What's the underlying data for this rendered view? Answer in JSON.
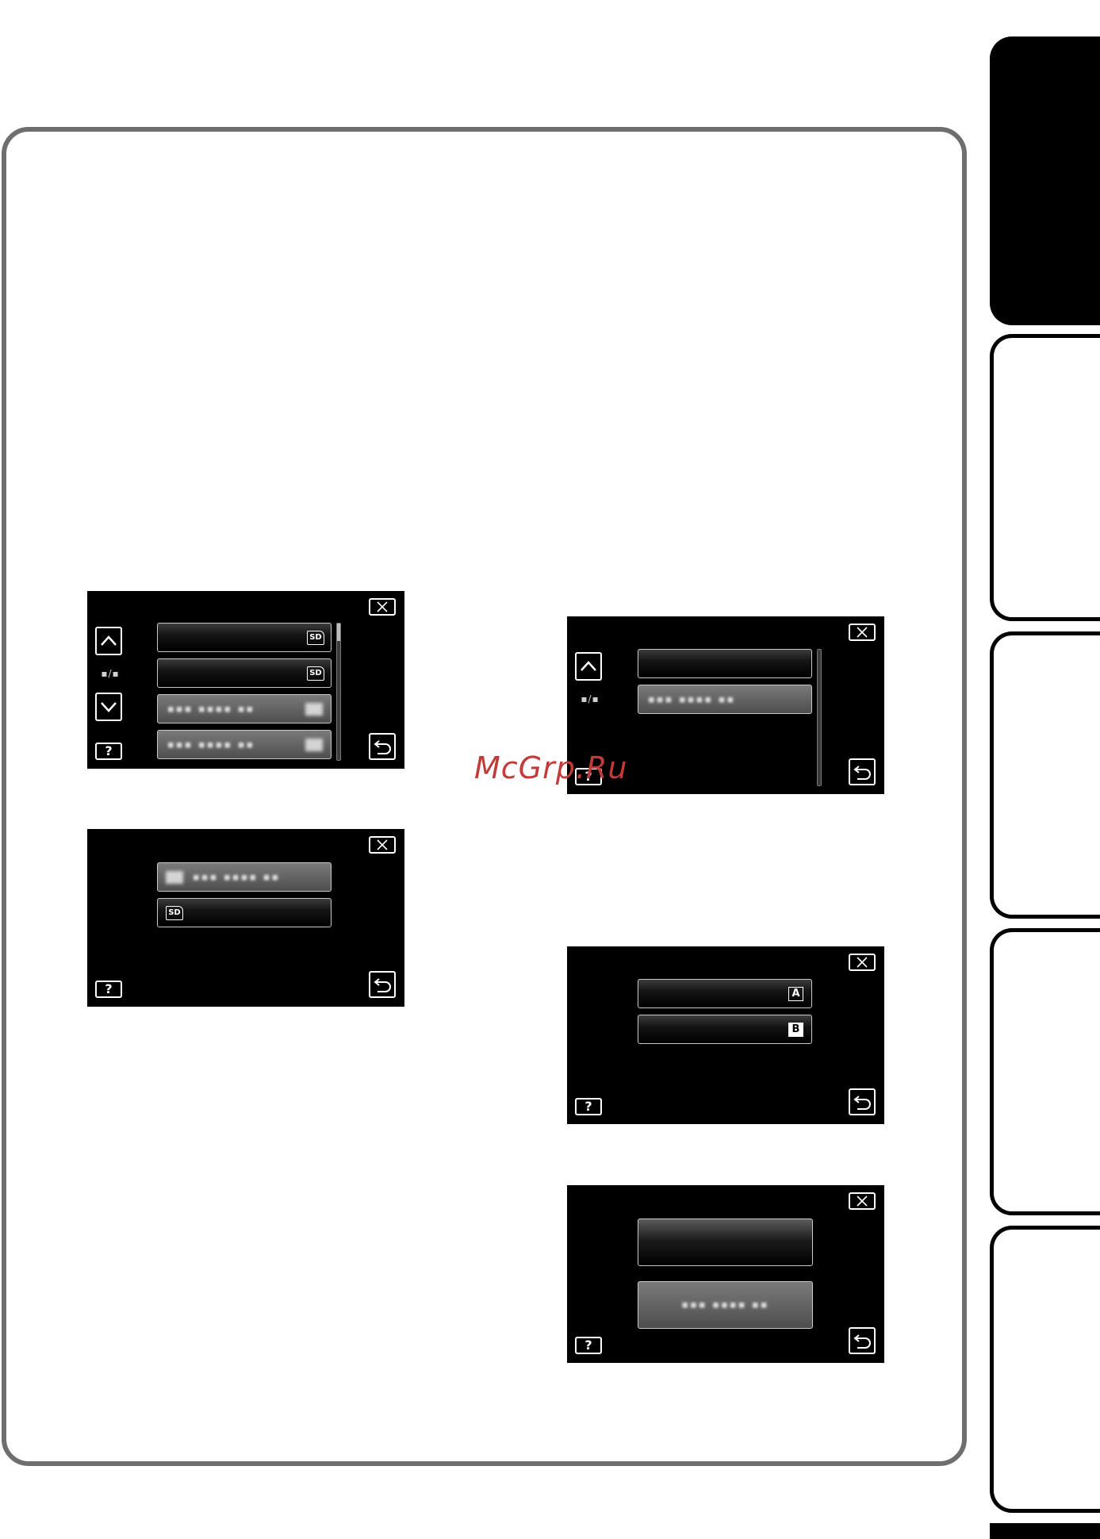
{
  "watermark": "McGrp.Ru",
  "colors": {
    "frame": "#6e6e6e",
    "screen_bg": "#000000",
    "tab_active": "#000000",
    "watermark": "#c23b3b"
  },
  "icons": {
    "close": "close-icon",
    "help": "help-icon",
    "back": "back-arrow-icon",
    "up": "chevron-up-icon",
    "down": "chevron-down-icon"
  },
  "screen1": {
    "help": "?",
    "page_indicator": "▪/▪",
    "items": [
      {
        "badge": "SD"
      },
      {
        "badge": "SD"
      },
      {
        "text": "▪▪▪ ▪▪▪▪ ▪▪"
      },
      {
        "text": "▪▪▪ ▪▪▪▪ ▪▪"
      }
    ]
  },
  "screen2": {
    "help": "?",
    "items": [
      {
        "text": "▪▪▪ ▪▪▪▪ ▪▪"
      },
      {
        "badge": "SD"
      }
    ]
  },
  "screen3": {
    "help": "?",
    "page_indicator": "▪/▪",
    "items": [
      {
        "text": ""
      },
      {
        "text": "▪▪▪ ▪▪▪▪ ▪▪"
      }
    ]
  },
  "screen4": {
    "help": "?",
    "items": [
      {
        "badge": "A"
      },
      {
        "badge": "B"
      }
    ]
  },
  "screen5": {
    "help": "?",
    "items": [
      {
        "text": ""
      },
      {
        "text": "▪▪▪ ▪▪▪▪ ▪▪"
      }
    ]
  }
}
